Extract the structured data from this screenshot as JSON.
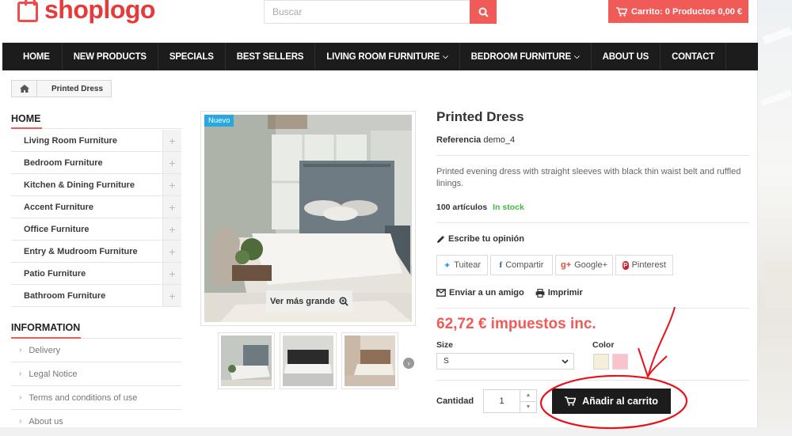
{
  "header": {
    "logo_text": "shoplogo",
    "search_placeholder": "Buscar",
    "cart_label": "Carrito: 0 Productos 0,00 €"
  },
  "nav": [
    {
      "label": "HOME"
    },
    {
      "label": "NEW PRODUCTS"
    },
    {
      "label": "SPECIALS"
    },
    {
      "label": "BEST SELLERS"
    },
    {
      "label": "LIVING ROOM FURNITURE",
      "dropdown": true
    },
    {
      "label": "BEDROOM FURNITURE",
      "dropdown": true
    },
    {
      "label": "ABOUT US"
    },
    {
      "label": "CONTACT"
    }
  ],
  "breadcrumb": {
    "current": "Printed Dress"
  },
  "sidebar": {
    "categories_title": "HOME",
    "categories": [
      "Living Room Furniture",
      "Bedroom Furniture",
      "Kitchen & Dining Furniture",
      "Accent Furniture",
      "Office Furniture",
      "Entry & Mudroom Furniture",
      "Patio Furniture",
      "Bathroom Furniture"
    ],
    "info_title": "INFORMATION",
    "info_links": [
      "Delivery",
      "Legal Notice",
      "Terms and conditions of use",
      "About us"
    ]
  },
  "gallery": {
    "badge": "Nuevo",
    "zoom_label": "Ver más grande"
  },
  "product": {
    "title": "Printed Dress",
    "ref_label": "Referencia",
    "ref_value": "demo_4",
    "description": "Printed evening dress with straight sleeves with black thin waist belt and ruffled linings.",
    "stock_count": "100 artículos",
    "stock_status": "In stock",
    "review_label": "Escribe tu opinión",
    "share": [
      {
        "icon": "twitter-icon",
        "label": "Tuitear",
        "glyph": "🐦"
      },
      {
        "icon": "facebook-icon",
        "label": "Compartir",
        "glyph": "f"
      },
      {
        "icon": "google-plus-icon",
        "label": "Google+",
        "glyph": "g+"
      },
      {
        "icon": "pinterest-icon",
        "label": "Pinterest",
        "glyph": "P"
      }
    ],
    "send_friend": "Enviar a un amigo",
    "print": "Imprimir",
    "price": "62,72 € impuestos inc.",
    "size_label": "Size",
    "size_value": "S",
    "color_label": "Color",
    "colors": [
      "#f3efd9",
      "#f7c4cc"
    ],
    "quantity_label": "Cantidad",
    "quantity_value": "1",
    "add_to_cart": "Añadir al carrito"
  },
  "colors": {
    "accent": "#f05a57",
    "nav_bg": "#1c1c1c",
    "stock_green": "#46b546",
    "badge_blue": "#29a8e0",
    "annotation_red": "#e8121a"
  }
}
